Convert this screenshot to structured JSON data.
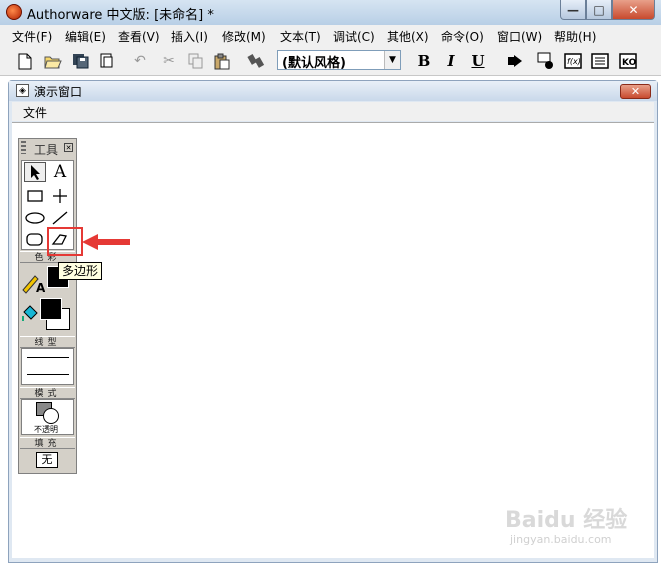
{
  "app": {
    "title": "Authorware 中文版: [未命名] *"
  },
  "window_controls": {
    "minimize": "—",
    "maximize": "□",
    "close": "✕"
  },
  "menubar": [
    "文件(F)",
    "编辑(E)",
    "查看(V)",
    "插入(I)",
    "修改(M)",
    "文本(T)",
    "调试(C)",
    "其他(X)",
    "命令(O)",
    "窗口(W)",
    "帮助(H)"
  ],
  "toolbar": {
    "style_select_value": "(默认风格)",
    "bold": "B",
    "italic": "I",
    "underline": "U",
    "icons": [
      "new-file-icon",
      "open-folder-icon",
      "save-all-icon",
      "import-icon",
      "undo-icon",
      "cut-icon",
      "copy-icon",
      "paste-icon",
      "find-icon",
      "run-icon",
      "control-panel-icon",
      "functions-icon",
      "variables-icon",
      "knowledge-objects-icon"
    ],
    "functions_label": "f(x)",
    "ko_label": "KO"
  },
  "presentation_window": {
    "title": "演示窗口",
    "menu_file": "文件"
  },
  "tools_palette": {
    "title": "工具",
    "text_tool": "A",
    "color_label": "色彩",
    "line_label": "线型",
    "mode_label": "模式",
    "mode_value": "不透明",
    "fill_label": "填充",
    "fill_value": "无"
  },
  "tooltip": {
    "text": "多边形"
  },
  "accent": {
    "highlight": "#e53935"
  },
  "watermark": {
    "main": "Baidu 经验",
    "sub": "jingyan.baidu.com"
  }
}
